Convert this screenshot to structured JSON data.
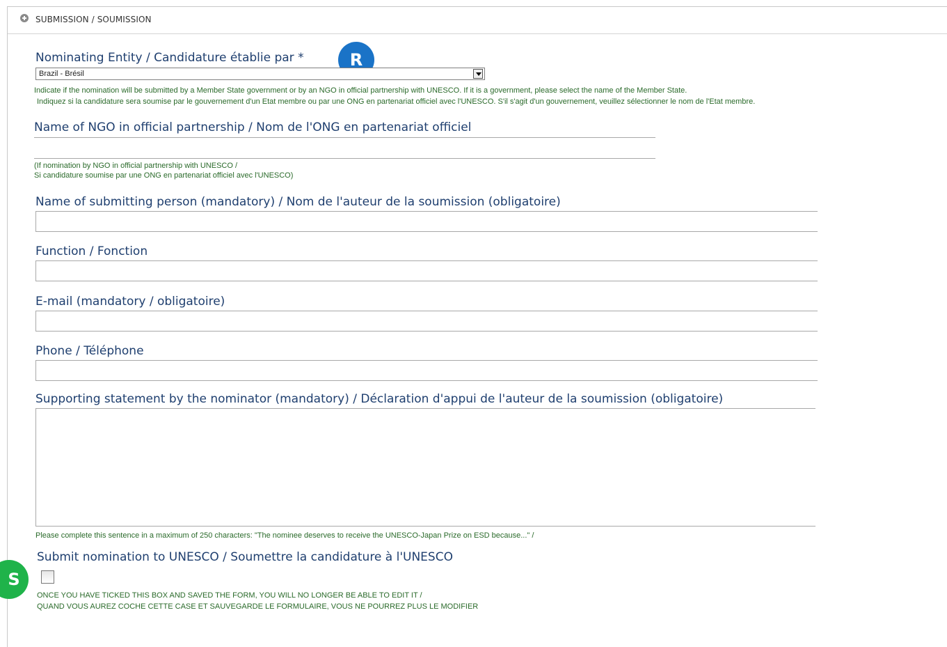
{
  "panel": {
    "title": "SUBMISSION / SOUMISSION",
    "collapse_icon": "plus-circle-icon"
  },
  "nominating_entity": {
    "label": "Nominating Entity / Candidature établie par",
    "required_marker": "*",
    "selected": "Brazil - Brésil",
    "help_en": "Indicate if the nomination will be submitted by a Member State government or by an NGO in official partnership with UNESCO. If it is a government, please select the name of the Member State.",
    "help_fr": "Indiquez si la candidature sera soumise par le gouvernement d'un Etat membre ou par une ONG en partenariat officiel avec l'UNESCO. S'il s'agit d'un gouvernement, veuillez sélectionner le nom de l'Etat membre."
  },
  "ngo": {
    "label": "Name of NGO in official partnership / Nom de l'ONG en partenariat officiel",
    "value": "",
    "help_en": "(If nomination by NGO in official partnership with UNESCO /",
    "help_fr": "Si candidature soumise par une ONG en partenariat officiel avec l'UNESCO)"
  },
  "submitter_name": {
    "label": "Name of submitting person (mandatory) / Nom de l'auteur de la soumission (obligatoire)",
    "value": ""
  },
  "function": {
    "label": "Function / Fonction",
    "value": ""
  },
  "email": {
    "label": "E-mail (mandatory / obligatoire)",
    "value": ""
  },
  "phone": {
    "label": "Phone / Téléphone",
    "value": ""
  },
  "statement": {
    "label": "Supporting statement by the nominator (mandatory) / Déclaration d'appui de l'auteur de la soumission (obligatoire)",
    "value": "",
    "help": "Please complete this sentence in a maximum of 250 characters: \"The nominee deserves to receive the UNESCO-Japan Prize on ESD because...\" /"
  },
  "submit": {
    "label": "Submit nomination to UNESCO / Soumettre la candidature à l'UNESCO",
    "checked": false,
    "warning_en": "ONCE YOU HAVE TICKED THIS BOX AND SAVED THE FORM, YOU WILL NO LONGER BE ABLE TO EDIT IT /",
    "warning_fr": "QUAND VOUS AUREZ COCHE CETTE CASE ET SAUVEGARDE LE FORMULAIRE, VOUS NE POURREZ PLUS LE MODIFIER"
  },
  "badges": {
    "r": {
      "letter": "R",
      "color": "#1a73c7"
    },
    "s": {
      "letter": "S",
      "color": "#1fb34a"
    }
  }
}
